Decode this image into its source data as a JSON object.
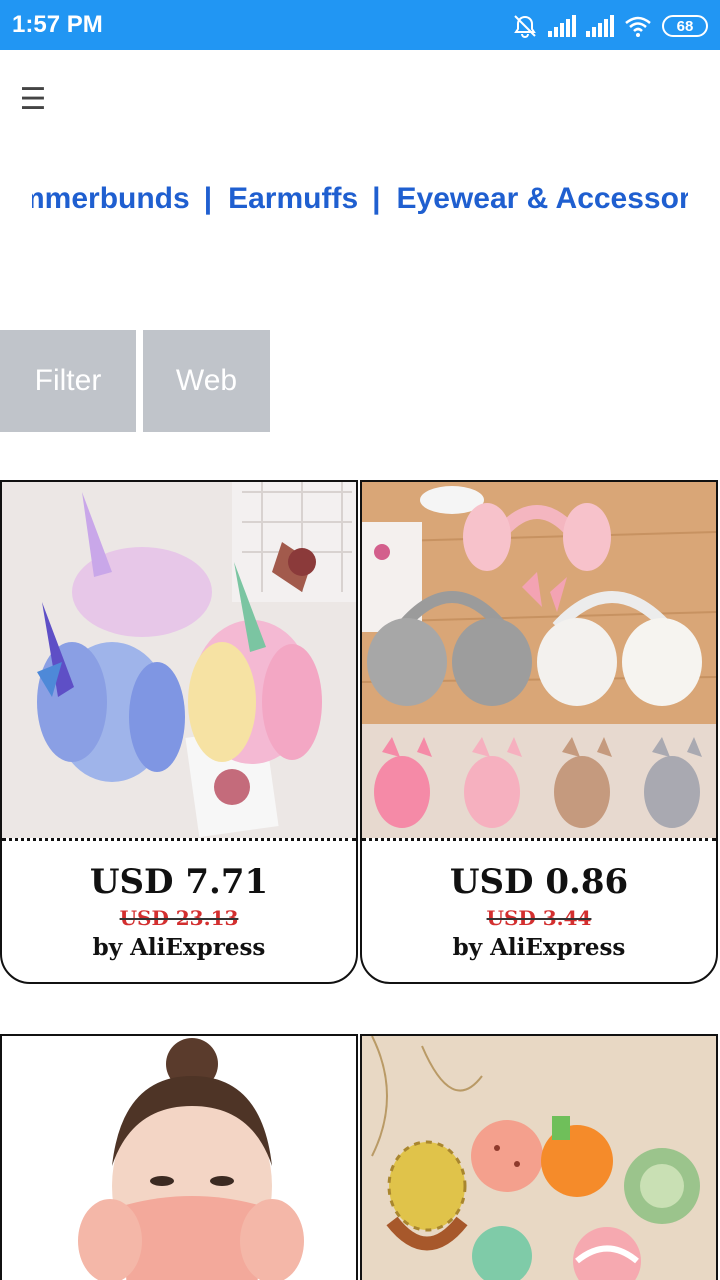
{
  "status_bar": {
    "time": "1:57 PM",
    "battery": "68",
    "icons": [
      "alarm-off-icon",
      "signal-icon",
      "signal-icon",
      "wifi-icon",
      "battery-icon"
    ]
  },
  "menu_icon": "menu-icon",
  "categories": [
    {
      "label": "Cummerbunds"
    },
    {
      "label": "Earmuffs"
    },
    {
      "label": "Eyewear & Accessories"
    }
  ],
  "category_separator": "|",
  "buttons": {
    "filter": "Filter",
    "web": "Web"
  },
  "products": [
    {
      "price": "USD 7.71",
      "old_price": "USD 23.13",
      "vendor": "by AliExpress",
      "image": "unicorn-earmuffs-image"
    },
    {
      "price": "USD 0.86",
      "old_price": "USD 3.44",
      "vendor": "by AliExpress",
      "image": "cat-ear-earmuffs-image"
    },
    {
      "image": "earmuff-mask-image"
    },
    {
      "image": "fruit-earmuffs-image"
    }
  ],
  "colors": {
    "status_bar": "#2196f3",
    "category_link": "#1f5fd0",
    "button_bg": "#c0c4ca",
    "old_price": "#d32f2f"
  }
}
